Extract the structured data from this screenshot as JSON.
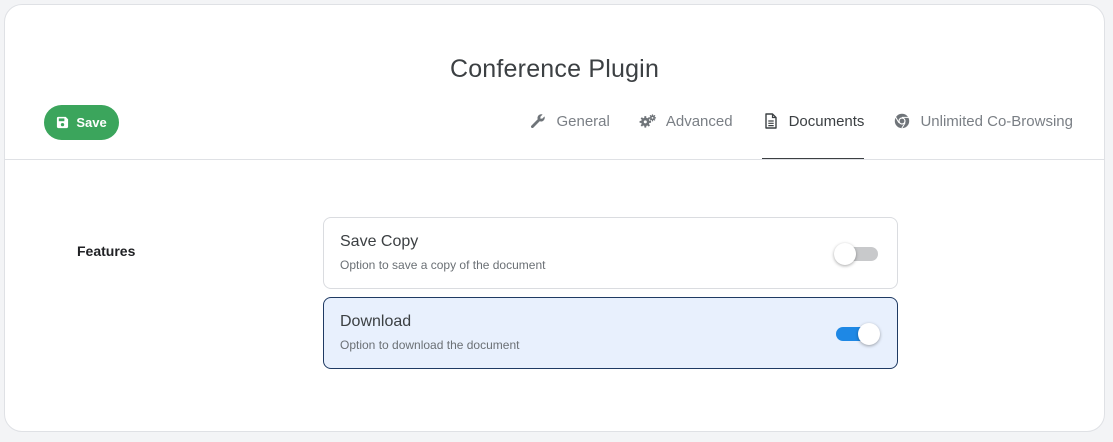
{
  "header": {
    "title": "Conference Plugin"
  },
  "toolbar": {
    "save_label": "Save"
  },
  "tabs": [
    {
      "label": "General",
      "icon": "wrench-icon",
      "active": false
    },
    {
      "label": "Advanced",
      "icon": "gears-icon",
      "active": false
    },
    {
      "label": "Documents",
      "icon": "document-icon",
      "active": true
    },
    {
      "label": "Unlimited Co-Browsing",
      "icon": "chrome-icon",
      "active": false
    }
  ],
  "features": {
    "label": "Features",
    "options": [
      {
        "title": "Save Copy",
        "description": "Option to save a copy of the document",
        "enabled": false
      },
      {
        "title": "Download",
        "description": "Option to download the document",
        "enabled": true
      }
    ]
  },
  "colors": {
    "save_button": "#3ba55c",
    "toggle_on": "#1e88e5",
    "toggle_off": "#c8c9cb",
    "selected_option_bg": "#e8f0fd",
    "selected_option_border": "#1f3a63"
  }
}
